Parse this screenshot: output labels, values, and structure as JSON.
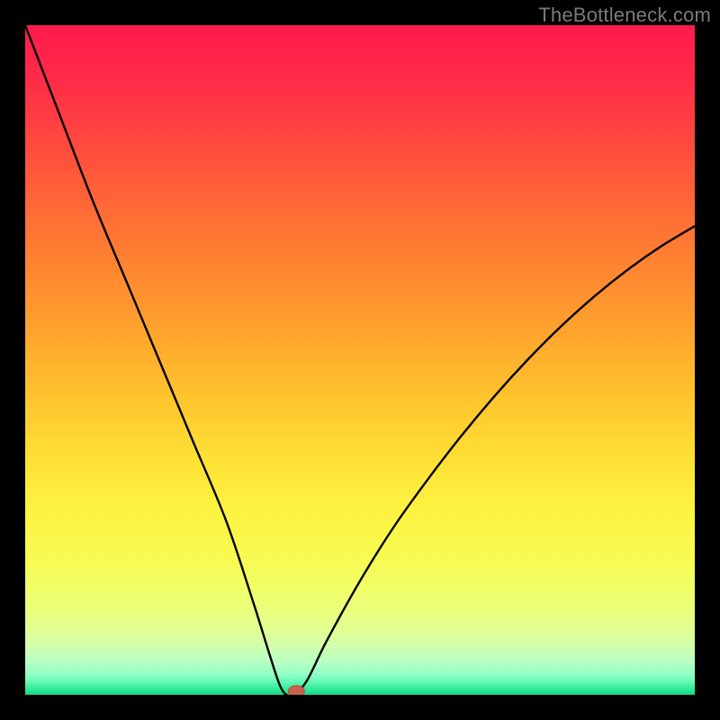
{
  "watermark": "TheBottleneck.com",
  "chart_data": {
    "type": "line",
    "title": "",
    "xlabel": "",
    "ylabel": "",
    "xlim": [
      0,
      100
    ],
    "ylim": [
      0,
      100
    ],
    "series": [
      {
        "name": "bottleneck-curve",
        "x": [
          0,
          5,
          10,
          15,
          20,
          25,
          30,
          34,
          36.5,
          38,
          39,
          40,
          42,
          45,
          50,
          55,
          60,
          65,
          70,
          75,
          80,
          85,
          90,
          95,
          100
        ],
        "y": [
          100,
          87,
          74,
          62,
          50,
          38,
          26,
          14,
          6,
          1.5,
          0,
          0,
          2,
          8,
          17,
          25,
          32,
          38.5,
          44.5,
          50,
          55,
          59.5,
          63.5,
          67,
          70
        ]
      }
    ],
    "marker": {
      "x": 40.5,
      "y": 0.5
    },
    "colors": {
      "gradient_stops": [
        {
          "pos": 0.0,
          "color": "#ff1a4f"
        },
        {
          "pos": 0.08,
          "color": "#ff2b48"
        },
        {
          "pos": 0.16,
          "color": "#ff4440"
        },
        {
          "pos": 0.24,
          "color": "#ff5e39"
        },
        {
          "pos": 0.32,
          "color": "#ff7833"
        },
        {
          "pos": 0.4,
          "color": "#ff912f"
        },
        {
          "pos": 0.48,
          "color": "#ffab2d"
        },
        {
          "pos": 0.56,
          "color": "#ffc52e"
        },
        {
          "pos": 0.64,
          "color": "#ffde34"
        },
        {
          "pos": 0.72,
          "color": "#fdf23f"
        },
        {
          "pos": 0.8,
          "color": "#f7fb53"
        },
        {
          "pos": 0.86,
          "color": "#edff72"
        },
        {
          "pos": 0.905,
          "color": "#e0ff94"
        },
        {
          "pos": 0.93,
          "color": "#cfffb0"
        },
        {
          "pos": 0.952,
          "color": "#b6ffc4"
        },
        {
          "pos": 0.97,
          "color": "#8effc5"
        },
        {
          "pos": 0.982,
          "color": "#5ef8b1"
        },
        {
          "pos": 0.992,
          "color": "#2fe897"
        },
        {
          "pos": 1.0,
          "color": "#16d685"
        }
      ],
      "curve": "#000000",
      "marker_fill": "#c9614f",
      "marker_stroke": "#b24f3f"
    }
  }
}
